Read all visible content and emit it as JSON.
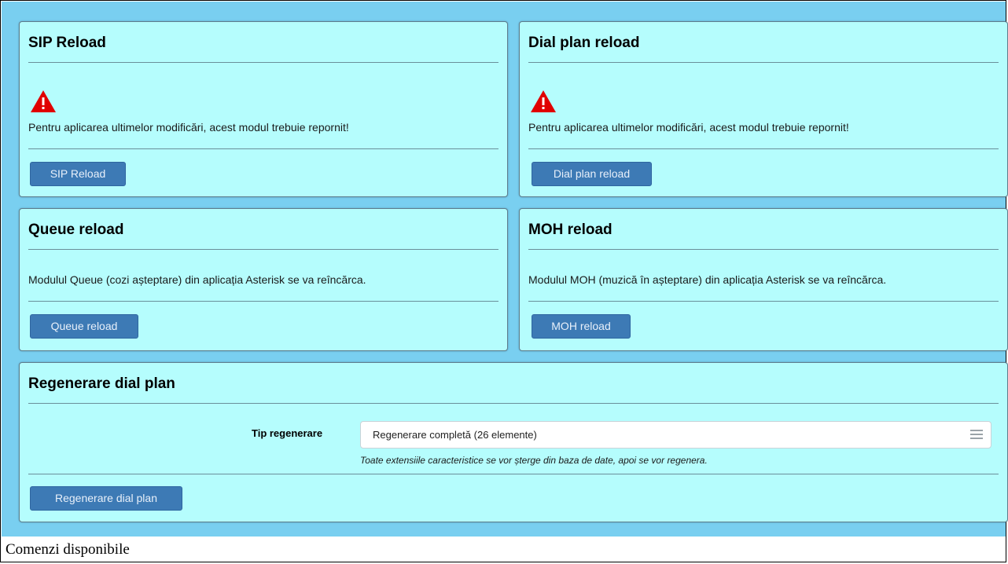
{
  "panels": {
    "sip": {
      "title": "SIP Reload",
      "message": "Pentru aplicarea ultimelor modificări, acest modul trebuie repornit!",
      "button": "SIP Reload"
    },
    "dialplan": {
      "title": "Dial plan reload",
      "message": "Pentru aplicarea ultimelor modificări, acest modul trebuie repornit!",
      "button": "Dial plan reload"
    },
    "queue": {
      "title": "Queue reload",
      "message": "Modulul Queue (cozi așteptare) din aplicația Asterisk se va reîncărca.",
      "button": "Queue reload"
    },
    "moh": {
      "title": "MOH reload",
      "message": "Modulul MOH (muzică în așteptare) din aplicația Asterisk se va reîncărca.",
      "button": "MOH reload"
    },
    "regen": {
      "title": "Regenerare dial plan",
      "field_label": "Tip regenerare",
      "select_value": "Regenerare completă (26 elemente)",
      "help_text": "Toate extensiile caracteristice se vor șterge din baza de date, apoi se vor regenera.",
      "button": "Regenerare dial plan"
    }
  },
  "caption": "Comenzi disponibile",
  "icons": {
    "warning": "warning-triangle-icon",
    "select_menu": "hamburger-menu-icon"
  },
  "colors": {
    "background": "#79cff0",
    "panel": "#b5fdfd",
    "button": "#3d7ab5",
    "warning": "#e00000"
  }
}
